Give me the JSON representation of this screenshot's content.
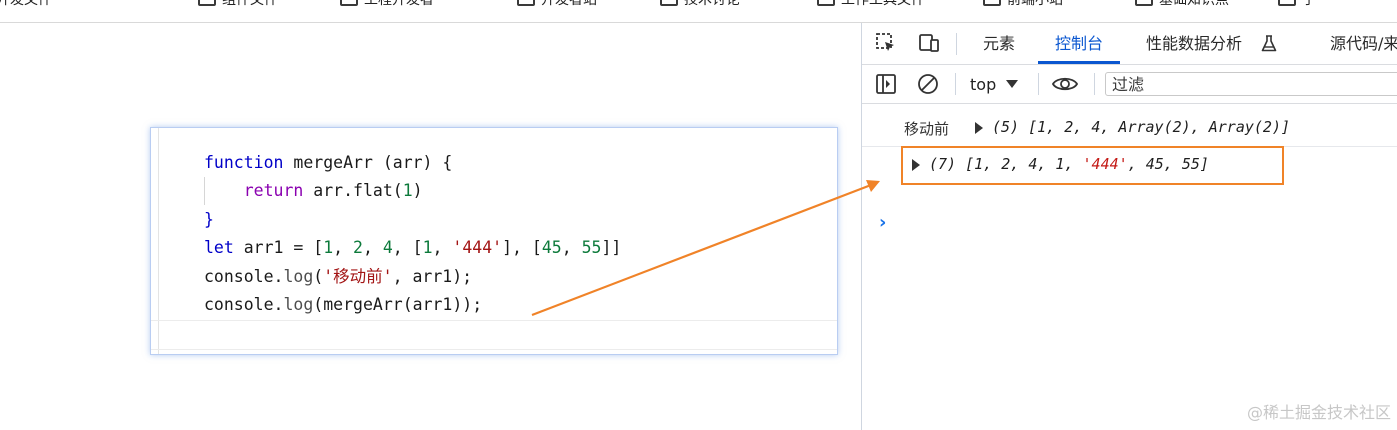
{
  "bookmarks": [
    {
      "label": "各前端开发文件"
    },
    {
      "label": "组件文件"
    },
    {
      "label": "工程开发者"
    },
    {
      "label": "开发者站"
    },
    {
      "label": "技术讨论"
    },
    {
      "label": "工作工具文件"
    },
    {
      "label": "前端小站"
    },
    {
      "label": "基础知识点"
    },
    {
      "label": "子"
    }
  ],
  "code": {
    "lines": [
      [
        {
          "t": "function",
          "c": "kw"
        },
        {
          "t": " mergeArr (arr) {",
          "c": "fn"
        }
      ],
      [
        {
          "t": "    ",
          "c": "fn"
        },
        {
          "t": "return",
          "c": "kw2"
        },
        {
          "t": " arr.flat(",
          "c": "fn"
        },
        {
          "t": "1",
          "c": "num"
        },
        {
          "t": ")",
          "c": "fn"
        }
      ],
      [
        {
          "t": "}",
          "c": "kw"
        }
      ],
      [
        {
          "t": "let",
          "c": "kw"
        },
        {
          "t": " arr1 = [",
          "c": "fn"
        },
        {
          "t": "1",
          "c": "num"
        },
        {
          "t": ", ",
          "c": "fn"
        },
        {
          "t": "2",
          "c": "num"
        },
        {
          "t": ", ",
          "c": "fn"
        },
        {
          "t": "4",
          "c": "num"
        },
        {
          "t": ", [",
          "c": "fn"
        },
        {
          "t": "1",
          "c": "num"
        },
        {
          "t": ", ",
          "c": "fn"
        },
        {
          "t": "'444'",
          "c": "str"
        },
        {
          "t": "], [",
          "c": "fn"
        },
        {
          "t": "45",
          "c": "num"
        },
        {
          "t": ", ",
          "c": "fn"
        },
        {
          "t": "55",
          "c": "num"
        },
        {
          "t": "]]",
          "c": "fn"
        }
      ],
      [
        {
          "t": "console.",
          "c": "fn"
        },
        {
          "t": "log",
          "c": "dim"
        },
        {
          "t": "(",
          "c": "fn"
        },
        {
          "t": "'移动前'",
          "c": "str"
        },
        {
          "t": ", arr1);",
          "c": "fn"
        }
      ],
      [
        {
          "t": "console.",
          "c": "fn"
        },
        {
          "t": "log",
          "c": "dim"
        },
        {
          "t": "(mergeArr(arr1));",
          "c": "fn"
        }
      ]
    ]
  },
  "devtools": {
    "tabs": {
      "elements": "元素",
      "console": "控制台",
      "performance": "性能数据分析",
      "sources": "源代码/来"
    },
    "toolbar": {
      "context": "top",
      "filter_placeholder": "过滤"
    },
    "console": {
      "msg1_label": "移动前",
      "msg1_value": "(5) [1, 2, 4, Array(2), Array(2)]",
      "msg2_count": "(7) [",
      "msg2_nums1": "1, 2, 4, 1, ",
      "msg2_str": "'444'",
      "msg2_nums2": ", 45, 55]",
      "prompt": "›"
    }
  },
  "watermark": "@稀土掘金技术社区",
  "colors": {
    "highlight": "#f08328",
    "accent": "#0b57d0"
  }
}
